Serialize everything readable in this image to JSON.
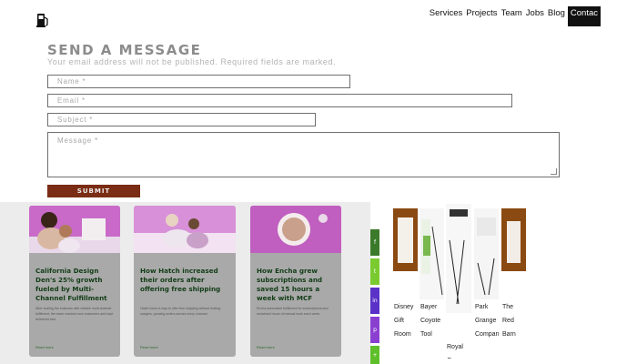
{
  "header": {
    "nav": [
      "Services",
      "Projects",
      "Team",
      "Jobs",
      "Blog"
    ],
    "nav_active": "Contac",
    "logo_icon": "fuel-pump-icon"
  },
  "form": {
    "title": "SEND A MESSAGE",
    "subtitle": "Your email address will not be published. Required fields are marked.",
    "name_placeholder": "Name *",
    "email_placeholder": "Email *",
    "subject_placeholder": "Subject *",
    "message_placeholder": "Message *",
    "submit_label": "SUBMIT",
    "submit_color": "#7a2c14"
  },
  "cards": [
    {
      "title": "California Design Den's 25% growth fueled by Multi-Channel Fulfillment",
      "text": "After scaling the business with reliable multi-channel fulfillment, the team reached new customers and kept deliveries fast.",
      "link": "Read more"
    },
    {
      "title": "How Hatch increased their orders after offering free shipping",
      "text": "Hatch found a way to offer free shipping without hurting margins, growing orders across every channel.",
      "link": "Read more"
    },
    {
      "title": "How Encha grew subscriptions and saved 15 hours a week with MCF",
      "text": "Encha automated fulfillment for subscriptions and reclaimed hours of manual work each week.",
      "link": "Read more"
    }
  ],
  "share_icons": [
    "facebook-icon",
    "twitter-icon",
    "linkedin-icon",
    "pinterest-icon",
    "share-icon"
  ],
  "share_glyphs": [
    "f",
    "t",
    "in",
    "p",
    "+"
  ],
  "share_colors": [
    "#3b7a2a",
    "#7acb2f",
    "#5a32c8",
    "#8b3fd1",
    "#5fbf2a"
  ],
  "tiles": [
    {
      "caption": "Disney Gift Room"
    },
    {
      "caption": "Bayer Coyote Tool"
    },
    {
      "caption": "Royal Grange"
    },
    {
      "caption": "Park Grange Company"
    },
    {
      "caption": "The Red Barn Ale House"
    }
  ]
}
